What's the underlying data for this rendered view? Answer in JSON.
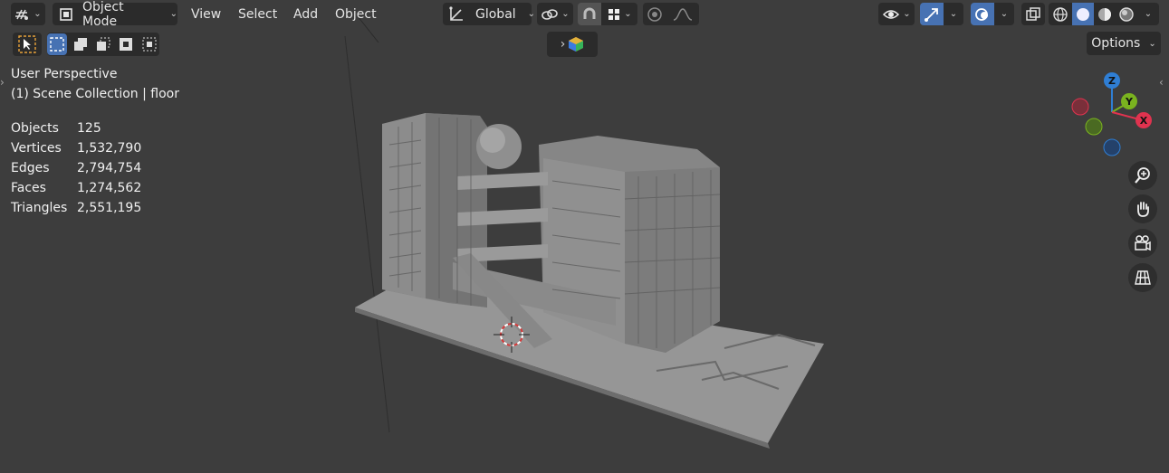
{
  "header": {
    "mode_label": "Object Mode",
    "menus": [
      "View",
      "Select",
      "Add",
      "Object"
    ],
    "transform_orientation": "Global",
    "options_label": "Options"
  },
  "overlay_text": {
    "view_name": "User Perspective",
    "collection": "(1) Scene Collection | floor"
  },
  "stats": [
    {
      "label": "Objects",
      "value": "125"
    },
    {
      "label": "Vertices",
      "value": "1,532,790"
    },
    {
      "label": "Edges",
      "value": "2,794,754"
    },
    {
      "label": "Faces",
      "value": "1,274,562"
    },
    {
      "label": "Triangles",
      "value": "2,551,195"
    }
  ],
  "gizmo": {
    "z": "Z",
    "y": "Y",
    "x": "X"
  },
  "colors": {
    "accent": "#4772b3",
    "x_axis": "#e0334f",
    "y_axis": "#7ab31f",
    "z_axis": "#2f7ed4",
    "viewport_bg": "#3d3d3d"
  },
  "icons": [
    "editor-type-icon",
    "object-mode-icon",
    "transform-pivot-icon",
    "link-icon",
    "snap-icon",
    "snap-grid-icon",
    "proportional-edit-icon",
    "falloff-icon",
    "visibility-icon",
    "gizmo-icon",
    "overlay-icon",
    "xray-icon",
    "wireframe-shading-icon",
    "solid-shading-icon",
    "material-shading-icon",
    "rendered-shading-icon",
    "zoom-icon",
    "pan-hand-icon",
    "camera-view-icon",
    "ortho-grid-icon"
  ]
}
